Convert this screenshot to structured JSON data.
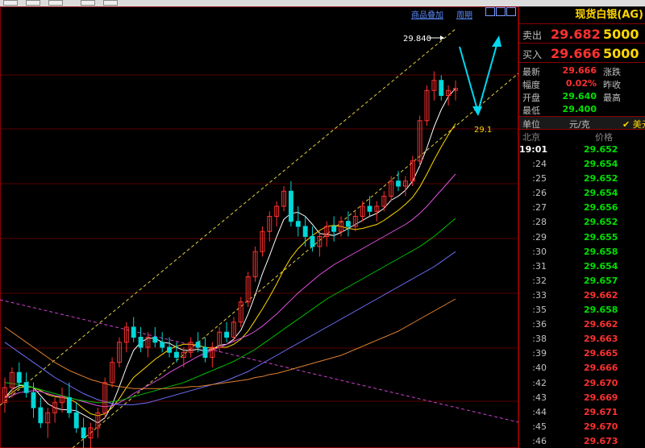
{
  "toolbar": {},
  "chart_links": {
    "product_overlay": "商品叠加",
    "period": "周期"
  },
  "chart_data": {
    "type": "candlestick",
    "title": "",
    "annotations": {
      "high_label": "29.840",
      "target_label": "29.1"
    },
    "ohlc": [
      [
        26.55,
        26.8,
        26.45,
        26.7
      ],
      [
        26.7,
        26.9,
        26.6,
        26.85
      ],
      [
        26.85,
        26.95,
        26.7,
        26.75
      ],
      [
        26.75,
        26.85,
        26.6,
        26.65
      ],
      [
        26.65,
        26.75,
        26.4,
        26.5
      ],
      [
        26.5,
        26.6,
        26.3,
        26.35
      ],
      [
        26.35,
        26.5,
        26.2,
        26.45
      ],
      [
        26.45,
        26.6,
        26.35,
        26.55
      ],
      [
        26.55,
        26.7,
        26.45,
        26.6
      ],
      [
        26.6,
        26.75,
        26.4,
        26.45
      ],
      [
        26.45,
        26.55,
        26.25,
        26.3
      ],
      [
        26.3,
        26.4,
        26.1,
        26.2
      ],
      [
        26.2,
        26.35,
        26.0,
        26.3
      ],
      [
        26.3,
        26.5,
        26.2,
        26.45
      ],
      [
        26.45,
        26.8,
        26.4,
        26.75
      ],
      [
        26.75,
        27.0,
        26.7,
        26.95
      ],
      [
        26.95,
        27.2,
        26.9,
        27.15
      ],
      [
        27.15,
        27.35,
        27.05,
        27.3
      ],
      [
        27.3,
        27.4,
        27.15,
        27.2
      ],
      [
        27.2,
        27.3,
        27.05,
        27.1
      ],
      [
        27.1,
        27.25,
        27.0,
        27.2
      ],
      [
        27.2,
        27.3,
        27.1,
        27.15
      ],
      [
        27.15,
        27.25,
        27.05,
        27.1
      ],
      [
        27.1,
        27.2,
        27.0,
        27.05
      ],
      [
        27.05,
        27.15,
        26.95,
        27.0
      ],
      [
        27.0,
        27.1,
        26.9,
        27.05
      ],
      [
        27.05,
        27.2,
        27.0,
        27.15
      ],
      [
        27.15,
        27.25,
        27.05,
        27.1
      ],
      [
        27.1,
        27.2,
        26.95,
        27.0
      ],
      [
        27.0,
        27.15,
        26.9,
        27.1
      ],
      [
        27.1,
        27.3,
        27.05,
        27.25
      ],
      [
        27.25,
        27.35,
        27.15,
        27.2
      ],
      [
        27.2,
        27.4,
        27.15,
        27.35
      ],
      [
        27.35,
        27.6,
        27.3,
        27.55
      ],
      [
        27.55,
        27.85,
        27.5,
        27.8
      ],
      [
        27.8,
        28.1,
        27.75,
        28.05
      ],
      [
        28.05,
        28.3,
        28.0,
        28.25
      ],
      [
        28.25,
        28.45,
        28.15,
        28.4
      ],
      [
        28.4,
        28.55,
        28.3,
        28.5
      ],
      [
        28.5,
        28.7,
        28.45,
        28.65
      ],
      [
        28.65,
        28.75,
        28.3,
        28.35
      ],
      [
        28.35,
        28.5,
        28.2,
        28.3
      ],
      [
        28.3,
        28.4,
        28.1,
        28.2
      ],
      [
        28.2,
        28.3,
        28.05,
        28.1
      ],
      [
        28.1,
        28.25,
        28.0,
        28.2
      ],
      [
        28.2,
        28.35,
        28.1,
        28.3
      ],
      [
        28.3,
        28.4,
        28.15,
        28.25
      ],
      [
        28.25,
        28.4,
        28.2,
        28.35
      ],
      [
        28.35,
        28.45,
        28.2,
        28.3
      ],
      [
        28.3,
        28.45,
        28.25,
        28.4
      ],
      [
        28.4,
        28.55,
        28.35,
        28.5
      ],
      [
        28.5,
        28.6,
        28.4,
        28.45
      ],
      [
        28.45,
        28.55,
        28.35,
        28.5
      ],
      [
        28.5,
        28.65,
        28.45,
        28.6
      ],
      [
        28.6,
        28.8,
        28.55,
        28.75
      ],
      [
        28.75,
        28.85,
        28.65,
        28.7
      ],
      [
        28.7,
        28.8,
        28.6,
        28.75
      ],
      [
        28.75,
        29.0,
        28.7,
        28.95
      ],
      [
        28.95,
        29.4,
        28.9,
        29.35
      ],
      [
        29.35,
        29.7,
        29.3,
        29.65
      ],
      [
        29.65,
        29.84,
        29.55,
        29.75
      ],
      [
        29.75,
        29.8,
        29.55,
        29.6
      ],
      [
        29.6,
        29.7,
        29.5,
        29.65
      ],
      [
        29.65,
        29.75,
        29.55,
        29.67
      ]
    ],
    "ma": [
      {
        "name": "MA5",
        "color": "#ffffff",
        "values": [
          26.6,
          26.68,
          26.72,
          26.72,
          26.7,
          26.62,
          26.54,
          26.5,
          26.48,
          26.48,
          26.47,
          26.43,
          26.39,
          26.35,
          26.4,
          26.53,
          26.71,
          26.9,
          27.07,
          27.15,
          27.19,
          27.19,
          27.15,
          27.14,
          27.1,
          27.07,
          27.07,
          27.08,
          27.06,
          27.08,
          27.12,
          27.13,
          27.18,
          27.27,
          27.43,
          27.62,
          27.83,
          28.01,
          28.2,
          28.37,
          28.43,
          28.44,
          28.4,
          28.32,
          28.23,
          28.22,
          28.21,
          28.24,
          28.28,
          28.32,
          28.36,
          28.4,
          28.43,
          28.48,
          28.56,
          28.6,
          28.66,
          28.75,
          28.9,
          29.08,
          29.29,
          29.46,
          29.59,
          29.67
        ]
      },
      {
        "name": "MA10",
        "color": "#ffd700",
        "values": [
          26.6,
          26.65,
          26.7,
          26.71,
          26.7,
          26.67,
          26.63,
          26.61,
          26.6,
          26.59,
          26.55,
          26.49,
          26.44,
          26.42,
          26.44,
          26.5,
          26.59,
          26.7,
          26.8,
          26.86,
          26.92,
          26.98,
          27.03,
          27.08,
          27.11,
          27.13,
          27.13,
          27.12,
          27.1,
          27.09,
          27.1,
          27.1,
          27.13,
          27.18,
          27.26,
          27.37,
          27.48,
          27.6,
          27.73,
          27.87,
          27.99,
          28.08,
          28.15,
          28.21,
          28.26,
          28.3,
          28.31,
          28.3,
          28.28,
          28.27,
          28.28,
          28.3,
          28.32,
          28.36,
          28.41,
          28.46,
          28.52,
          28.59,
          28.69,
          28.82,
          28.96,
          29.09,
          29.21,
          29.32
        ]
      },
      {
        "name": "MA20",
        "color": "#e050e0",
        "values": [
          26.6,
          26.62,
          26.65,
          26.66,
          26.67,
          26.66,
          26.64,
          26.62,
          26.61,
          26.6,
          26.58,
          26.56,
          26.54,
          26.52,
          26.51,
          26.52,
          26.55,
          26.59,
          26.64,
          26.68,
          26.72,
          26.76,
          26.8,
          26.85,
          26.89,
          26.93,
          26.97,
          27.01,
          27.04,
          27.07,
          27.1,
          27.13,
          27.16,
          27.19,
          27.22,
          27.26,
          27.31,
          27.37,
          27.43,
          27.5,
          27.57,
          27.64,
          27.7,
          27.76,
          27.82,
          27.87,
          27.92,
          27.96,
          28.0,
          28.04,
          28.08,
          28.12,
          28.16,
          28.2,
          28.24,
          28.28,
          28.32,
          28.37,
          28.43,
          28.5,
          28.58,
          28.66,
          28.74,
          28.82
        ]
      },
      {
        "name": "MA40",
        "color": "#00c000",
        "values": [
          26.75,
          26.74,
          26.73,
          26.72,
          26.7,
          26.68,
          26.66,
          26.64,
          26.62,
          26.6,
          26.58,
          26.57,
          26.56,
          26.55,
          26.55,
          26.56,
          26.57,
          26.59,
          26.61,
          26.63,
          26.65,
          26.67,
          26.69,
          26.71,
          26.73,
          26.75,
          26.78,
          26.81,
          26.84,
          26.87,
          26.9,
          26.93,
          26.96,
          27.0,
          27.04,
          27.08,
          27.13,
          27.18,
          27.23,
          27.28,
          27.33,
          27.38,
          27.43,
          27.48,
          27.53,
          27.58,
          27.62,
          27.66,
          27.7,
          27.74,
          27.78,
          27.82,
          27.86,
          27.9,
          27.94,
          27.98,
          28.02,
          28.06,
          28.1,
          28.15,
          28.2,
          28.26,
          28.32,
          28.38
        ]
      },
      {
        "name": "MA60",
        "color": "#7070ff",
        "values": [
          27.15,
          27.1,
          27.05,
          27.0,
          26.95,
          26.9,
          26.85,
          26.8,
          26.76,
          26.72,
          26.68,
          26.64,
          26.61,
          26.58,
          26.56,
          26.54,
          26.53,
          26.53,
          26.53,
          26.54,
          26.55,
          26.57,
          26.59,
          26.61,
          26.63,
          26.65,
          26.67,
          26.69,
          26.71,
          26.73,
          26.75,
          26.77,
          26.8,
          26.83,
          26.86,
          26.9,
          26.94,
          26.98,
          27.02,
          27.06,
          27.1,
          27.14,
          27.18,
          27.22,
          27.26,
          27.3,
          27.34,
          27.38,
          27.42,
          27.46,
          27.5,
          27.54,
          27.58,
          27.62,
          27.66,
          27.7,
          27.74,
          27.78,
          27.82,
          27.86,
          27.9,
          27.95,
          28.0,
          28.05
        ]
      },
      {
        "name": "MA120",
        "color": "#e08030",
        "values": [
          27.3,
          27.25,
          27.2,
          27.15,
          27.1,
          27.05,
          27.0,
          26.95,
          26.91,
          26.87,
          26.84,
          26.81,
          26.78,
          26.76,
          26.74,
          26.72,
          26.71,
          26.7,
          26.69,
          26.69,
          26.69,
          26.69,
          26.69,
          26.69,
          26.7,
          26.7,
          26.71,
          26.71,
          26.72,
          26.73,
          26.74,
          26.75,
          26.76,
          26.77,
          26.78,
          26.8,
          26.81,
          26.83,
          26.84,
          26.86,
          26.88,
          26.9,
          26.92,
          26.94,
          26.96,
          26.98,
          27.0,
          27.02,
          27.05,
          27.08,
          27.11,
          27.14,
          27.17,
          27.2,
          27.23,
          27.26,
          27.3,
          27.34,
          27.38,
          27.42,
          27.46,
          27.5,
          27.54,
          27.58
        ]
      }
    ],
    "ylim": [
      26.1,
      30.1
    ],
    "grid": true
  },
  "panel": {
    "title": "现货白银(AG)",
    "sell": {
      "label": "卖出",
      "price": "29.682",
      "volume": "5000"
    },
    "buy": {
      "label": "买入",
      "price": "29.666",
      "volume": "5000"
    },
    "stats": [
      {
        "label": "最新",
        "value": "29.666",
        "color": "#ff3030",
        "label2": "涨跌"
      },
      {
        "label": "幅度",
        "value": "0.02%",
        "color": "#ff3030",
        "label2": "昨收"
      },
      {
        "label": "开盘",
        "value": "29.640",
        "color": "#00e000",
        "label2": "最高"
      },
      {
        "label": "最低",
        "value": "29.400",
        "color": "#00e000",
        "label2": ""
      }
    ],
    "unit_label": "单位",
    "unit_value": "元/克",
    "currency": "✔ 美元",
    "ticks_header": {
      "place": "北京",
      "price": "价格"
    },
    "ticks": [
      {
        "time": "19:01",
        "price": "29.652",
        "dir": "dn"
      },
      {
        "time": ":24",
        "price": "29.654",
        "dir": "dn"
      },
      {
        "time": ":25",
        "price": "29.652",
        "dir": "dn"
      },
      {
        "time": ":26",
        "price": "29.654",
        "dir": "dn"
      },
      {
        "time": ":27",
        "price": "29.656",
        "dir": "dn"
      },
      {
        "time": ":28",
        "price": "29.652",
        "dir": "dn"
      },
      {
        "time": ":29",
        "price": "29.655",
        "dir": "dn"
      },
      {
        "time": ":30",
        "price": "29.658",
        "dir": "dn"
      },
      {
        "time": ":31",
        "price": "29.654",
        "dir": "dn"
      },
      {
        "time": ":32",
        "price": "29.657",
        "dir": "dn"
      },
      {
        "time": ":33",
        "price": "29.662",
        "dir": "up"
      },
      {
        "time": ":35",
        "price": "29.658",
        "dir": "dn"
      },
      {
        "time": ":36",
        "price": "29.662",
        "dir": "up"
      },
      {
        "time": ":38",
        "price": "29.663",
        "dir": "up"
      },
      {
        "time": ":39",
        "price": "29.665",
        "dir": "up"
      },
      {
        "time": ":40",
        "price": "29.666",
        "dir": "up"
      },
      {
        "time": ":42",
        "price": "29.670",
        "dir": "up"
      },
      {
        "time": ":43",
        "price": "29.669",
        "dir": "up"
      },
      {
        "time": ":44",
        "price": "29.671",
        "dir": "up"
      },
      {
        "time": ":45",
        "price": "29.670",
        "dir": "up"
      },
      {
        "time": ":46",
        "price": "29.673",
        "dir": "up"
      }
    ]
  }
}
